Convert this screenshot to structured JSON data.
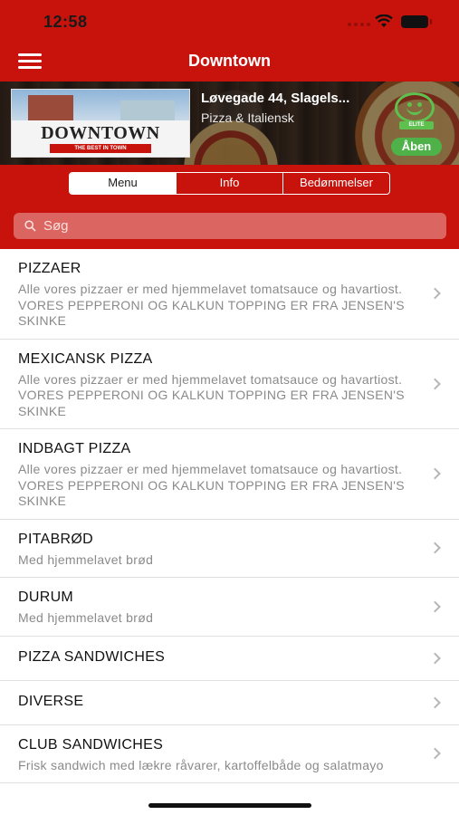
{
  "status_bar": {
    "time": "12:58"
  },
  "navbar": {
    "title": "Downtown"
  },
  "restaurant": {
    "logo_text": "DOWNTOWN",
    "logo_tagline": "THE BEST IN TOWN",
    "address": "Løvegade 44, Slagels...",
    "cuisine": "Pizza & Italiensk",
    "smiley_label": "ELITE",
    "open_status": "Åben"
  },
  "tabs": [
    "Menu",
    "Info",
    "Bedømmelser"
  ],
  "search": {
    "placeholder": "Søg"
  },
  "menu_categories": [
    {
      "title": "PIZZAER",
      "description": "Alle vores pizzaer er med hjemmelavet tomatsauce og havartiost. VORES PEPPERONI OG KALKUN TOPPING ER FRA JENSEN'S SKINKE"
    },
    {
      "title": "MEXICANSK PIZZA",
      "description": "Alle vores pizzaer er med hjemmelavet tomatsauce og havartiost. VORES PEPPERONI OG KALKUN TOPPING ER FRA JENSEN'S SKINKE"
    },
    {
      "title": "INDBAGT PIZZA",
      "description": "Alle vores pizzaer er med hjemmelavet tomatsauce og havartiost. VORES PEPPERONI OG KALKUN TOPPING ER FRA JENSEN'S SKINKE"
    },
    {
      "title": "PITABRØD",
      "description": "Med hjemmelavet brød"
    },
    {
      "title": "DURUM",
      "description": "Med hjemmelavet brød"
    },
    {
      "title": "PIZZA SANDWICHES",
      "description": ""
    },
    {
      "title": "DIVERSE",
      "description": ""
    },
    {
      "title": "CLUB SANDWICHES",
      "description": "Frisk sandwich med lækre råvarer, kartoffelbåde og salatmayo"
    }
  ],
  "colors": {
    "brand_red": "#c8130d",
    "open_green": "#4fb248"
  }
}
